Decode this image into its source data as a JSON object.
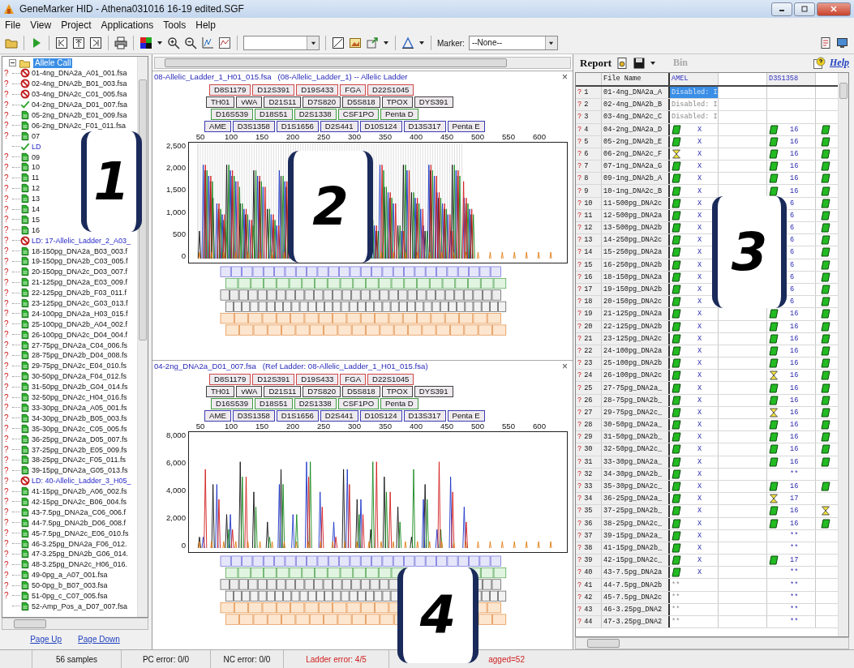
{
  "window": {
    "title": "GeneMarker HID - Athena031016 16-19 edited.SGF"
  },
  "menu": [
    "File",
    "View",
    "Project",
    "Applications",
    "Tools",
    "Help"
  ],
  "toolbar": {
    "marker_label": "Marker:",
    "marker_value": "--None--"
  },
  "tree": {
    "root": "Allele Call",
    "root_selected": true,
    "items": [
      {
        "mark": "?",
        "kind": "disabled",
        "ladder": false,
        "text": "01-4ng_DNA2a_A01_001.fsa"
      },
      {
        "mark": "?",
        "kind": "disabled",
        "ladder": false,
        "text": "02-4ng_DNA2b_B01_003.fsa"
      },
      {
        "mark": "?",
        "kind": "disabled",
        "ladder": false,
        "text": "03-4ng_DNA2c_C01_005.fsa"
      },
      {
        "mark": "?",
        "kind": "done",
        "ladder": false,
        "text": "04-2ng_DNA2a_D01_007.fsa"
      },
      {
        "mark": "?",
        "kind": "file",
        "ladder": false,
        "text": "05-2ng_DNA2b_E01_009.fsa"
      },
      {
        "mark": "?",
        "kind": "file",
        "ladder": false,
        "text": "06-2ng_DNA2c_F01_011.fsa"
      },
      {
        "mark": "?",
        "kind": "file",
        "ladder": false,
        "text": "07"
      },
      {
        "kind": "done",
        "ladder": true,
        "text": "LD"
      },
      {
        "mark": "?",
        "kind": "file",
        "ladder": false,
        "text": "09"
      },
      {
        "mark": "?",
        "kind": "file",
        "ladder": false,
        "text": "10"
      },
      {
        "mark": "?",
        "kind": "file",
        "ladder": false,
        "text": "11"
      },
      {
        "mark": "?",
        "kind": "file",
        "ladder": false,
        "text": "12"
      },
      {
        "mark": "?",
        "kind": "file",
        "ladder": false,
        "text": "13"
      },
      {
        "mark": "?",
        "kind": "file",
        "ladder": false,
        "text": "14"
      },
      {
        "mark": "?",
        "kind": "file",
        "ladder": false,
        "text": "15"
      },
      {
        "mark": "?",
        "kind": "file",
        "ladder": false,
        "text": "16"
      },
      {
        "mark": "?",
        "kind": "disabled",
        "ladder": true,
        "text": "LD: 17-Allelic_Ladder_2_A03_"
      },
      {
        "mark": "?",
        "kind": "file",
        "ladder": false,
        "text": "18-150pg_DNA2a_B03_003.f"
      },
      {
        "mark": "?",
        "kind": "file",
        "ladder": false,
        "text": "19-150pg_DNA2b_C03_005.f"
      },
      {
        "mark": "?",
        "kind": "file",
        "ladder": false,
        "text": "20-150pg_DNA2c_D03_007.f"
      },
      {
        "mark": "?",
        "kind": "file",
        "ladder": false,
        "text": "21-125pg_DNA2a_E03_009.f"
      },
      {
        "mark": "?",
        "kind": "file",
        "ladder": false,
        "text": "22-125pg_DNA2b_F03_011.f"
      },
      {
        "mark": "?",
        "kind": "file",
        "ladder": false,
        "text": "23-125pg_DNA2c_G03_013.f"
      },
      {
        "mark": "?",
        "kind": "file",
        "ladder": false,
        "text": "24-100pg_DNA2a_H03_015.f"
      },
      {
        "mark": "?",
        "kind": "file",
        "ladder": false,
        "text": "25-100pg_DNA2b_A04_002.f"
      },
      {
        "mark": "?",
        "kind": "file",
        "ladder": false,
        "text": "26-100pg_DNA2c_D04_004.f"
      },
      {
        "mark": "?",
        "kind": "file",
        "ladder": false,
        "text": "27-75pg_DNA2a_C04_006.fs"
      },
      {
        "mark": "?",
        "kind": "file",
        "ladder": false,
        "text": "28-75pg_DNA2b_D04_008.fs"
      },
      {
        "mark": "?",
        "kind": "file",
        "ladder": false,
        "text": "29-75pg_DNA2c_E04_010.fs"
      },
      {
        "mark": "?",
        "kind": "file",
        "ladder": false,
        "text": "30-50pg_DNA2a_F04_012.fs"
      },
      {
        "mark": "?",
        "kind": "file",
        "ladder": false,
        "text": "31-50pg_DNA2b_G04_014.fs"
      },
      {
        "mark": "?",
        "kind": "file",
        "ladder": false,
        "text": "32-50pg_DNA2c_H04_016.fs"
      },
      {
        "mark": "?",
        "kind": "file",
        "ladder": false,
        "text": "33-30pg_DNA2a_A05_001.fs"
      },
      {
        "mark": "?",
        "kind": "file",
        "ladder": false,
        "text": "34-30pg_DNA2b_B05_003.fs"
      },
      {
        "mark": "?",
        "kind": "file",
        "ladder": false,
        "text": "35-30pg_DNA2c_C05_005.fs"
      },
      {
        "mark": "?",
        "kind": "file",
        "ladder": false,
        "text": "36-25pg_DNA2a_D05_007.fs"
      },
      {
        "mark": "?",
        "kind": "file",
        "ladder": false,
        "text": "37-25pg_DNA2b_E05_009.fs"
      },
      {
        "mark": "?",
        "kind": "file",
        "ladder": false,
        "text": "38-25pg_DNA2c_F05_011.fs"
      },
      {
        "mark": "?",
        "kind": "file",
        "ladder": false,
        "text": "39-15pg_DNA2a_G05_013.fs"
      },
      {
        "mark": "?",
        "kind": "disabled",
        "ladder": true,
        "text": "LD: 40-Allelic_Ladder_3_H05_"
      },
      {
        "mark": "?",
        "kind": "file",
        "ladder": false,
        "text": "41-15pg_DNA2b_A06_002.fs"
      },
      {
        "mark": "?",
        "kind": "file",
        "ladder": false,
        "text": "42-15pg_DNA2c_B06_004.fs"
      },
      {
        "mark": "?",
        "kind": "file",
        "ladder": false,
        "text": "43-7.5pg_DNA2a_C06_006.f"
      },
      {
        "mark": "?",
        "kind": "file",
        "ladder": false,
        "text": "44-7.5pg_DNA2b_D06_008.f"
      },
      {
        "mark": "?",
        "kind": "file",
        "ladder": false,
        "text": "45-7.5pg_DNA2c_E06_010.fs"
      },
      {
        "mark": "?",
        "kind": "file",
        "ladder": false,
        "text": "46-3.25pg_DNA2a_F06_012."
      },
      {
        "mark": "?",
        "kind": "file",
        "ladder": false,
        "text": "47-3.25pg_DNA2b_G06_014."
      },
      {
        "mark": "?",
        "kind": "file",
        "ladder": false,
        "text": "48-3.25pg_DNA2c_H06_016."
      },
      {
        "mark": "?",
        "kind": "file",
        "ladder": false,
        "text": "49-0pg_a_A07_001.fsa"
      },
      {
        "mark": "?",
        "kind": "file",
        "ladder": false,
        "text": "50-0pg_b_B07_003.fsa"
      },
      {
        "mark": "?",
        "kind": "file",
        "ladder": false,
        "text": "51-0pg_c_C07_005.fsa"
      },
      {
        "kind": "file",
        "ladder": false,
        "text": "52-Amp_Pos_a_D07_007.fsa"
      }
    ],
    "page_links": [
      "Page Up",
      "Page Down"
    ]
  },
  "panels": [
    {
      "title": "08-Allelic_Ladder_1_H01_015.fsa   (08-Allelic_Ladder_1) -- Allelic Ladder",
      "close": "×",
      "kind": "ladder",
      "marker_rows": [
        {
          "color": "#d04848",
          "markers": [
            "D8S1179",
            "D12S391",
            "D19S433",
            "FGA",
            "D22S1045"
          ]
        },
        {
          "color": "#404040",
          "markers": [
            "TH01",
            "vWA",
            "D21S11",
            "D7S820",
            "D5S818",
            "TPOX",
            "DYS391"
          ]
        },
        {
          "color": "#3c9a3c",
          "markers": [
            "D16S539",
            "D18S51",
            "D2S1338",
            "CSF1PO",
            "Penta D"
          ]
        },
        {
          "color": "#3c3cb4",
          "markers": [
            "AME",
            "D3S1358",
            "D1S1656",
            "D2S441",
            "D10S124",
            "D13S317",
            "Penta E"
          ]
        }
      ],
      "x_ticks": [
        "50",
        "100",
        "150",
        "200",
        "250",
        "300",
        "350",
        "400",
        "450",
        "500",
        "550",
        "600"
      ],
      "y_ticks": [
        "2,500",
        "2,000",
        "1,500",
        "1,000",
        "500",
        "0"
      ]
    },
    {
      "title": "04-2ng_DNA2a_D01_007.fsa   (Ref Ladder: 08-Allelic_Ladder_1_H01_015.fsa)",
      "close": "×",
      "kind": "sample",
      "marker_rows": [
        {
          "color": "#d04848",
          "markers": [
            "D8S1179",
            "D12S391",
            "D19S433",
            "FGA",
            "D22S1045"
          ]
        },
        {
          "color": "#404040",
          "markers": [
            "TH01",
            "vWA",
            "D21S11",
            "D7S820",
            "D5S818",
            "TPOX",
            "DYS391"
          ]
        },
        {
          "color": "#3c9a3c",
          "markers": [
            "D16S539",
            "D18S51",
            "D2S1338",
            "CSF1PO",
            "Penta D"
          ]
        },
        {
          "color": "#3c3cb4",
          "markers": [
            "AME",
            "D3S1358",
            "D1S1656",
            "D2S441",
            "D10S124",
            "D13S317",
            "Penta E"
          ]
        }
      ],
      "x_ticks": [
        "50",
        "100",
        "150",
        "200",
        "250",
        "300",
        "350",
        "400",
        "450",
        "500",
        "550",
        "600"
      ],
      "y_ticks": [
        "8,000",
        "6,000",
        "4,000",
        "2,000",
        "0"
      ]
    }
  ],
  "report": {
    "title": "Report",
    "bin": "Bin",
    "help": "Help",
    "columns": [
      "File Name",
      "AMEL",
      "D3S1358"
    ],
    "rows": [
      {
        "mark": "?",
        "num": "1",
        "file": "01-4ng_DNA2a_A",
        "amel": "Disabled: I",
        "selected": true
      },
      {
        "mark": "?",
        "num": "2",
        "file": "02-4ng_DNA2b_B",
        "amel": "Disabled: I",
        "selected": false
      },
      {
        "mark": "?",
        "num": "3",
        "file": "03-4ng_DNA2c_C",
        "amel": "Disabled: I",
        "selected": false
      },
      {
        "mark": "?",
        "num": "4",
        "file": "04-2ng_DNA2a_D",
        "amel_flag": {
          "kind": "ok"
        },
        "amel": "X",
        "d3_flag": {
          "kind": "ok"
        },
        "d3": "16",
        "c5_flag": {
          "kind": "ok"
        },
        "selected": false
      },
      {
        "mark": "?",
        "num": "5",
        "file": "05-2ng_DNA2b_E",
        "amel_flag": {
          "kind": "ok"
        },
        "amel": "X",
        "d3_flag": {
          "kind": "ok"
        },
        "d3": "16",
        "c5_flag": {
          "kind": "ok"
        },
        "selected": false
      },
      {
        "mark": "?",
        "num": "6",
        "file": "06-2ng_DNA2c_F",
        "amel_flag": {
          "kind": "pending"
        },
        "amel": "X",
        "d3_flag": {
          "kind": "ok"
        },
        "d3": "16",
        "c5_flag": {
          "kind": "ok"
        },
        "selected": false
      },
      {
        "mark": "?",
        "num": "7",
        "file": "07-1ng_DNA2a_G",
        "amel_flag": {
          "kind": "ok"
        },
        "amel": "X",
        "d3_flag": {
          "kind": "ok"
        },
        "d3": "16",
        "c5_flag": {
          "kind": "ok"
        },
        "selected": false
      },
      {
        "mark": "?",
        "num": "8",
        "file": "09-1ng_DNA2b_A",
        "amel_flag": {
          "kind": "ok"
        },
        "amel": "X",
        "d3_flag": {
          "kind": "ok"
        },
        "d3": "16",
        "c5_flag": {
          "kind": "ok"
        },
        "selected": false
      },
      {
        "mark": "?",
        "num": "9",
        "file": "10-1ng_DNA2c_B",
        "amel_flag": {
          "kind": "ok"
        },
        "amel": "X",
        "d3_flag": {
          "kind": "ok"
        },
        "d3": "16",
        "c5_flag": {
          "kind": "ok"
        },
        "selected": false
      },
      {
        "mark": "?",
        "num": "10",
        "file": "11-500pg_DNA2c",
        "amel_flag": {
          "kind": "ok"
        },
        "amel": "X",
        "d3": "6",
        "c5_flag": {
          "kind": "ok"
        },
        "selected": false
      },
      {
        "mark": "?",
        "num": "11",
        "file": "12-500pg_DNA2a",
        "amel_flag": {
          "kind": "ok"
        },
        "amel": "X",
        "d3": "6",
        "c5_flag": {
          "kind": "ok"
        },
        "selected": false
      },
      {
        "mark": "?",
        "num": "12",
        "file": "13-500pg_DNA2b",
        "amel_flag": {
          "kind": "ok"
        },
        "amel": "X",
        "d3": "6",
        "c5_flag": {
          "kind": "ok"
        },
        "selected": false
      },
      {
        "mark": "?",
        "num": "13",
        "file": "14-250pg_DNA2c",
        "amel_flag": {
          "kind": "ok"
        },
        "amel": "X",
        "d3": "6",
        "c5_flag": {
          "kind": "ok"
        },
        "selected": false
      },
      {
        "mark": "?",
        "num": "14",
        "file": "15-250pg_DNA2a",
        "amel_flag": {
          "kind": "ok"
        },
        "amel": "X",
        "d3": "6",
        "c5_flag": {
          "kind": "ok"
        },
        "selected": false
      },
      {
        "mark": "?",
        "num": "15",
        "file": "16-250pg_DNA2b",
        "amel_flag": {
          "kind": "ok"
        },
        "amel": "X",
        "d3": "6",
        "c5_flag": {
          "kind": "ok"
        },
        "selected": false
      },
      {
        "mark": "?",
        "num": "16",
        "file": "18-150pg_DNA2a",
        "amel_flag": {
          "kind": "ok"
        },
        "amel": "X",
        "d3": "6",
        "c5_flag": {
          "kind": "ok"
        },
        "selected": false
      },
      {
        "mark": "?",
        "num": "17",
        "file": "19-150pg_DNA2b",
        "amel_flag": {
          "kind": "ok"
        },
        "amel": "X",
        "d3": "6",
        "c5_flag": {
          "kind": "ok"
        },
        "selected": false
      },
      {
        "mark": "?",
        "num": "18",
        "file": "20-150pg_DNA2c",
        "amel_flag": {
          "kind": "ok"
        },
        "amel": "X",
        "d3": "6",
        "c5_flag": {
          "kind": "ok"
        },
        "selected": false
      },
      {
        "mark": "?",
        "num": "19",
        "file": "21-125pg_DNA2a",
        "amel_flag": {
          "kind": "ok"
        },
        "amel": "X",
        "d3_flag": {
          "kind": "ok"
        },
        "d3": "16",
        "c5_flag": {
          "kind": "ok"
        },
        "selected": false
      },
      {
        "mark": "?",
        "num": "20",
        "file": "22-125pg_DNA2b",
        "amel_flag": {
          "kind": "ok"
        },
        "amel": "X",
        "d3_flag": {
          "kind": "ok"
        },
        "d3": "16",
        "c5_flag": {
          "kind": "ok"
        },
        "selected": false
      },
      {
        "mark": "?",
        "num": "21",
        "file": "23-125pg_DNA2c",
        "amel_flag": {
          "kind": "ok"
        },
        "amel": "X",
        "d3_flag": {
          "kind": "ok"
        },
        "d3": "16",
        "c5_flag": {
          "kind": "ok"
        },
        "selected": false
      },
      {
        "mark": "?",
        "num": "22",
        "file": "24-100pg_DNA2a",
        "amel_flag": {
          "kind": "ok"
        },
        "amel": "X",
        "d3_flag": {
          "kind": "ok"
        },
        "d3": "16",
        "c5_flag": {
          "kind": "ok"
        },
        "selected": false
      },
      {
        "mark": "?",
        "num": "23",
        "file": "25-100pg_DNA2b",
        "amel_flag": {
          "kind": "ok"
        },
        "amel": "X",
        "d3_flag": {
          "kind": "ok"
        },
        "d3": "16",
        "c5_flag": {
          "kind": "ok"
        },
        "selected": false
      },
      {
        "mark": "?",
        "num": "24",
        "file": "26-100pg_DNA2c",
        "amel_flag": {
          "kind": "ok"
        },
        "amel": "X",
        "d3_flag": {
          "kind": "pending"
        },
        "d3": "16",
        "c5_flag": {
          "kind": "ok"
        },
        "selected": false
      },
      {
        "mark": "?",
        "num": "25",
        "file": "27-75pg_DNA2a_",
        "amel_flag": {
          "kind": "ok"
        },
        "amel": "X",
        "d3_flag": {
          "kind": "ok"
        },
        "d3": "16",
        "c5_flag": {
          "kind": "ok"
        },
        "selected": false
      },
      {
        "mark": "?",
        "num": "26",
        "file": "28-75pg_DNA2b_",
        "amel_flag": {
          "kind": "ok"
        },
        "amel": "X",
        "d3_flag": {
          "kind": "ok"
        },
        "d3": "16",
        "c5_flag": {
          "kind": "ok"
        },
        "selected": false
      },
      {
        "mark": "?",
        "num": "27",
        "file": "29-75pg_DNA2c_",
        "amel_flag": {
          "kind": "ok"
        },
        "amel": "X",
        "d3_flag": {
          "kind": "pending"
        },
        "d3": "16",
        "c5_flag": {
          "kind": "ok"
        },
        "selected": false
      },
      {
        "mark": "?",
        "num": "28",
        "file": "30-50pg_DNA2a_",
        "amel_flag": {
          "kind": "ok"
        },
        "amel": "X",
        "d3_flag": {
          "kind": "ok"
        },
        "d3": "16",
        "c5_flag": {
          "kind": "ok"
        },
        "selected": false
      },
      {
        "mark": "?",
        "num": "29",
        "file": "31-50pg_DNA2b_",
        "amel_flag": {
          "kind": "ok"
        },
        "amel": "X",
        "d3_flag": {
          "kind": "ok"
        },
        "d3": "16",
        "c5_flag": {
          "kind": "ok"
        },
        "selected": false
      },
      {
        "mark": "?",
        "num": "30",
        "file": "32-50pg_DNA2c_",
        "amel_flag": {
          "kind": "ok"
        },
        "amel": "X",
        "d3_flag": {
          "kind": "ok"
        },
        "d3": "16",
        "c5_flag": {
          "kind": "ok"
        },
        "selected": false
      },
      {
        "mark": "?",
        "num": "31",
        "file": "33-30pg_DNA2a_",
        "amel_flag": {
          "kind": "ok"
        },
        "amel": "X",
        "d3_flag": {
          "kind": "ok"
        },
        "d3": "16",
        "c5_flag": {
          "kind": "ok"
        },
        "selected": false
      },
      {
        "mark": "?",
        "num": "32",
        "file": "34-30pg_DNA2b_",
        "amel_flag": {
          "kind": "ok"
        },
        "amel": "X",
        "d3": "**",
        "selected": false
      },
      {
        "mark": "?",
        "num": "33",
        "file": "35-30pg_DNA2c_",
        "amel_flag": {
          "kind": "ok"
        },
        "amel": "X",
        "d3_flag": {
          "kind": "ok"
        },
        "d3": "16",
        "c5_flag": {
          "kind": "ok"
        },
        "selected": false
      },
      {
        "mark": "?",
        "num": "34",
        "file": "36-25pg_DNA2a_",
        "amel_flag": {
          "kind": "ok"
        },
        "amel": "X",
        "d3_flag": {
          "kind": "pending"
        },
        "d3": "17",
        "selected": false
      },
      {
        "mark": "?",
        "num": "35",
        "file": "37-25pg_DNA2b_",
        "amel_flag": {
          "kind": "ok"
        },
        "amel": "X",
        "d3_flag": {
          "kind": "ok"
        },
        "d3": "16",
        "c5_flag": {
          "kind": "pending"
        },
        "selected": false
      },
      {
        "mark": "?",
        "num": "36",
        "file": "38-25pg_DNA2c_",
        "amel_flag": {
          "kind": "ok"
        },
        "amel": "X",
        "d3_flag": {
          "kind": "ok"
        },
        "d3": "16",
        "c5_flag": {
          "kind": "ok"
        },
        "selected": false
      },
      {
        "mark": "?",
        "num": "37",
        "file": "39-15pg_DNA2a_",
        "amel_flag": {
          "kind": "ok"
        },
        "amel": "X",
        "d3": "**",
        "selected": false
      },
      {
        "mark": "?",
        "num": "38",
        "file": "41-15pg_DNA2b_",
        "amel_flag": {
          "kind": "ok"
        },
        "amel": "X",
        "d3": "**",
        "selected": false
      },
      {
        "mark": "?",
        "num": "39",
        "file": "42-15pg_DNA2c_",
        "amel_flag": {
          "kind": "ok"
        },
        "amel": "X",
        "d3_flag": {
          "kind": "ok"
        },
        "d3": "17",
        "selected": false
      },
      {
        "mark": "?",
        "num": "40",
        "file": "43-7.5pg_DNA2a",
        "amel_flag": {
          "kind": "ok"
        },
        "amel": "X",
        "d3": "**",
        "selected": false
      },
      {
        "mark": "?",
        "num": "41",
        "file": "44-7.5pg_DNA2b",
        "amel": "**",
        "d3": "**",
        "selected": false
      },
      {
        "mark": "?",
        "num": "42",
        "file": "45-7.5pg_DNA2c",
        "amel": "**",
        "d3": "**",
        "selected": false
      },
      {
        "mark": "?",
        "num": "43",
        "file": "46-3.25pg_DNA2",
        "amel": "**",
        "d3": "**",
        "selected": false
      },
      {
        "mark": "?",
        "num": "44",
        "file": "47-3.25pg_DNA2",
        "amel": "**",
        "d3": "**",
        "selected": false
      }
    ]
  },
  "status_bar": [
    {
      "text": "56 samples",
      "error": false
    },
    {
      "text": "PC error: 0/0",
      "error": false
    },
    {
      "text": "NC error: 0/0",
      "error": false
    },
    {
      "text": "Ladder error: 4/5",
      "error": true
    },
    {
      "text": "agged=52",
      "error": true
    }
  ],
  "annotations": [
    {
      "label": "1"
    },
    {
      "label": "2"
    },
    {
      "label": "3"
    },
    {
      "label": "4"
    }
  ]
}
